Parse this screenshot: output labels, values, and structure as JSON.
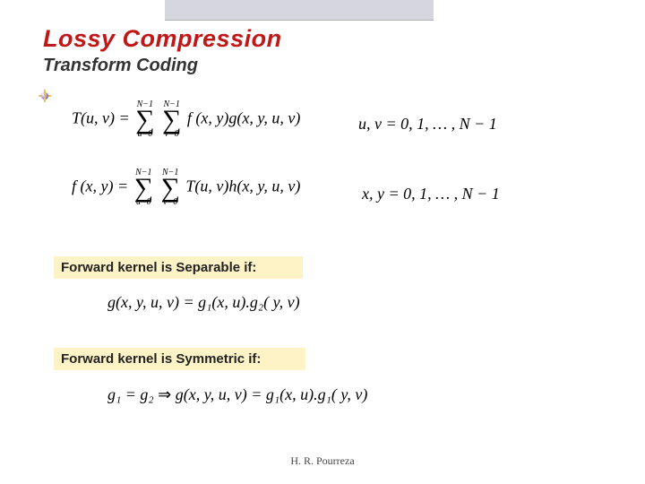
{
  "title": "Lossy Compression",
  "subtitle": "Transform Coding",
  "equations": {
    "forward": {
      "lhs": "T(u, v) =",
      "sum1_upper": "N−1",
      "sum1_lower": "u=0",
      "sum2_upper": "N−1",
      "sum2_lower": "v=0",
      "body": " f (x, y)g(x, y, u, v)",
      "domain": "u, v = 0, 1, … , N − 1"
    },
    "inverse": {
      "lhs": "f (x, y) =",
      "sum1_upper": "N−1",
      "sum1_lower": "u=0",
      "sum2_upper": "N−1",
      "sum2_lower": "v=0",
      "body": " T(u, v)h(x, y, u, v)",
      "domain": "x, y = 0, 1, … , N − 1"
    },
    "separable": "g(x, y, u, v) = g₁(x, u).g₂( y, v)",
    "symmetric_lhs": "g₁ = g₂",
    "symmetric_impl": " ⇒ ",
    "symmetric_rhs": "g(x, y, u, v) = g₁(x, u).g₁( y, v)"
  },
  "labels": {
    "separable": "Forward kernel is Separable if:",
    "symmetric": "Forward kernel is Symmetric if:"
  },
  "footer": "H. R. Pourreza"
}
